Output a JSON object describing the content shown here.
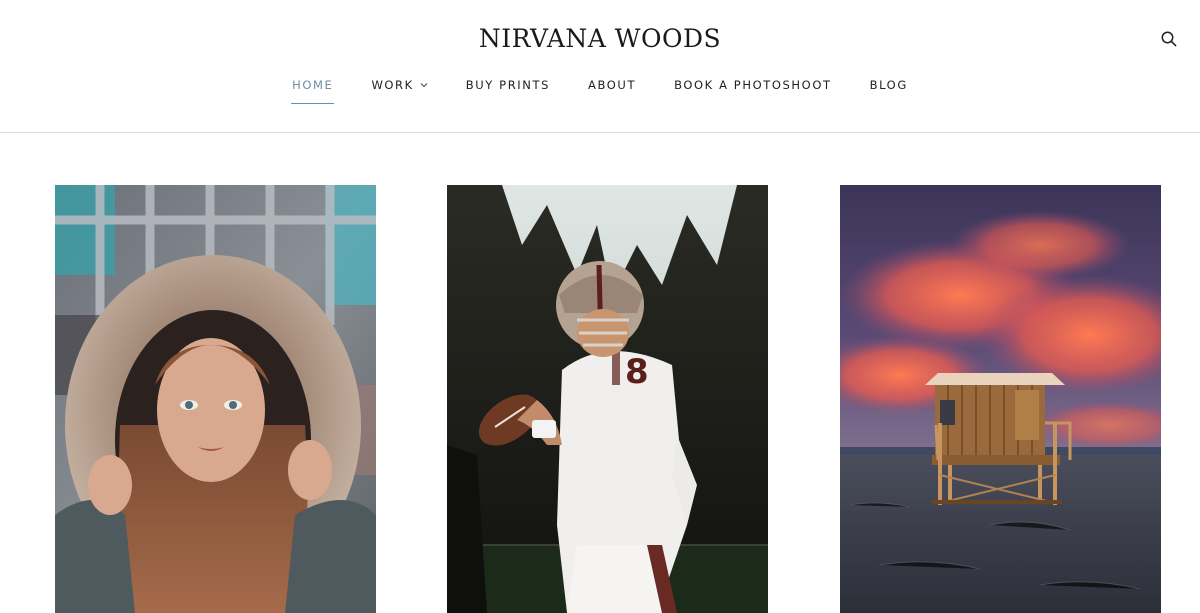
{
  "site": {
    "title": "NIRVANA WOODS"
  },
  "header": {
    "search_icon": "search-icon"
  },
  "nav": {
    "items": [
      {
        "label": "HOME",
        "active": true
      },
      {
        "label": "WORK",
        "dropdown": true
      },
      {
        "label": "BUY PRINTS"
      },
      {
        "label": "ABOUT"
      },
      {
        "label": "BOOK A PHOTOSHOOT"
      },
      {
        "label": "BLOG"
      }
    ]
  },
  "gallery": {
    "photos": [
      {
        "subject": "woman-in-fur-hood"
      },
      {
        "subject": "football-quarterback"
      },
      {
        "subject": "lifeguard-hut-at-sunset"
      }
    ]
  },
  "colors": {
    "accent": "#6f8fa6",
    "divider": "#dcdcdc",
    "text": "#1f1f1f"
  }
}
